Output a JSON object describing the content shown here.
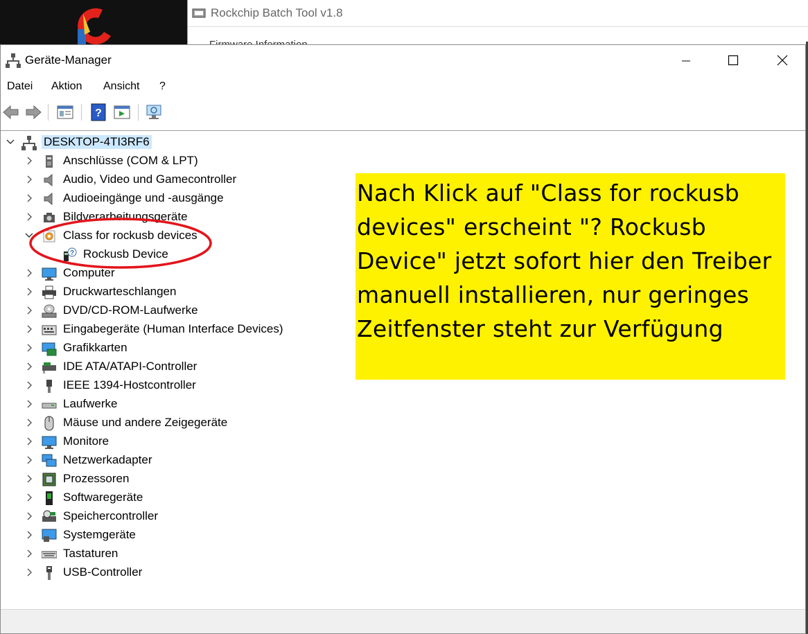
{
  "background_window": {
    "title": "Rockchip Batch Tool v1.8",
    "cut_text": "Firmware Information"
  },
  "window": {
    "title": "Geräte-Manager",
    "controls": {
      "minimize": "minimize",
      "maximize": "maximize",
      "close": "close"
    }
  },
  "menu": {
    "file": "Datei",
    "action": "Aktion",
    "view": "Ansicht",
    "help": "?"
  },
  "tree": {
    "root": "DESKTOP-4TI3RF6",
    "items": [
      {
        "label": "Anschlüsse (COM & LPT)",
        "icon": "port-icon",
        "expanded": false
      },
      {
        "label": "Audio, Video und Gamecontroller",
        "icon": "speaker-icon",
        "expanded": false
      },
      {
        "label": "Audioeingänge und -ausgänge",
        "icon": "speaker-icon",
        "expanded": false
      },
      {
        "label": "Bildverarbeitungsgeräte",
        "icon": "camera-icon",
        "expanded": false
      },
      {
        "label": "Class for rockusb devices",
        "icon": "gear-device-icon",
        "expanded": true
      },
      {
        "label": "Rockusb Device",
        "icon": "unknown-device-icon",
        "child": true
      },
      {
        "label": "Computer",
        "icon": "monitor-icon",
        "expanded": false
      },
      {
        "label": "Druckwarteschlangen",
        "icon": "printer-icon",
        "expanded": false
      },
      {
        "label": "DVD/CD-ROM-Laufwerke",
        "icon": "disc-icon",
        "expanded": false
      },
      {
        "label": "Eingabegeräte (Human Interface Devices)",
        "icon": "keyboard-hid-icon",
        "expanded": false
      },
      {
        "label": "Grafikkarten",
        "icon": "display-adapter-icon",
        "expanded": false
      },
      {
        "label": "IDE ATA/ATAPI-Controller",
        "icon": "ide-controller-icon",
        "expanded": false
      },
      {
        "label": "IEEE 1394-Hostcontroller",
        "icon": "firewire-icon",
        "expanded": false
      },
      {
        "label": "Laufwerke",
        "icon": "drive-icon",
        "expanded": false
      },
      {
        "label": "Mäuse und andere Zeigegeräte",
        "icon": "mouse-icon",
        "expanded": false
      },
      {
        "label": "Monitore",
        "icon": "monitor-icon",
        "expanded": false
      },
      {
        "label": "Netzwerkadapter",
        "icon": "network-icon",
        "expanded": false
      },
      {
        "label": "Prozessoren",
        "icon": "cpu-icon",
        "expanded": false
      },
      {
        "label": "Softwaregeräte",
        "icon": "software-device-icon",
        "expanded": false
      },
      {
        "label": "Speichercontroller",
        "icon": "storage-controller-icon",
        "expanded": false
      },
      {
        "label": "Systemgeräte",
        "icon": "system-device-icon",
        "expanded": false
      },
      {
        "label": "Tastaturen",
        "icon": "keyboard-icon",
        "expanded": false
      },
      {
        "label": "USB-Controller",
        "icon": "usb-icon",
        "expanded": false
      }
    ]
  },
  "annotation": {
    "text": "Nach Klick auf \"Class for rockusb devices\" erscheint \"? Rockusb Device\" jetzt sofort hier den Treiber manuell installieren, nur geringes Zeitfenster steht zur Verfügung",
    "background": "#fff200",
    "ellipse_color": "#e3141b"
  }
}
